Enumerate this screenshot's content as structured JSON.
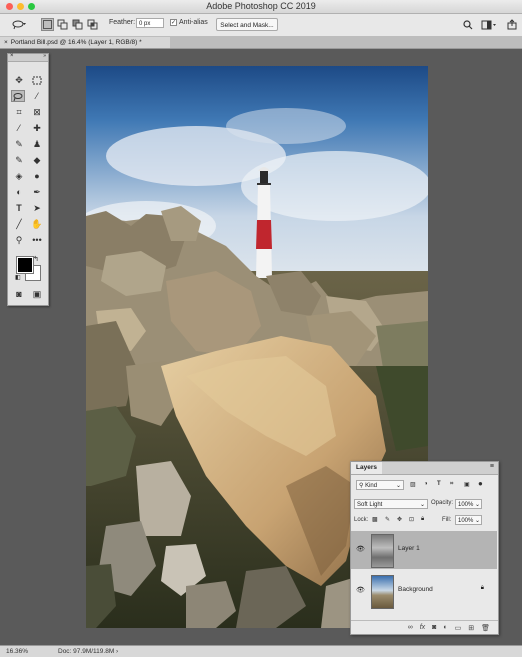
{
  "window": {
    "title": "Adobe Photoshop CC 2019"
  },
  "options_bar": {
    "feather_label": "Feather:",
    "feather_value": "0 px",
    "anti_alias_label": "Anti-alias",
    "select_mask_label": "Select and Mask..."
  },
  "document_tab": {
    "label": "Portland Bill.psd @ 16.4% (Layer 1, RGB/8) *"
  },
  "layers_panel": {
    "tab_label": "Layers",
    "filter_kind": "Kind",
    "blend_mode": "Soft Light",
    "opacity_label": "Opacity:",
    "opacity_value": "100%",
    "lock_label": "Lock:",
    "fill_label": "Fill:",
    "fill_value": "100%",
    "layers": [
      {
        "name": "Layer 1",
        "selected": true,
        "visible": true
      },
      {
        "name": "Background",
        "selected": false,
        "visible": true,
        "locked": true
      }
    ]
  },
  "status_bar": {
    "zoom": "16.36%",
    "doc_info": "Doc: 97.9M/119.8M"
  },
  "colors": {
    "accent_selection": "#b4b4b4",
    "stripe_red": "#c0262e"
  }
}
